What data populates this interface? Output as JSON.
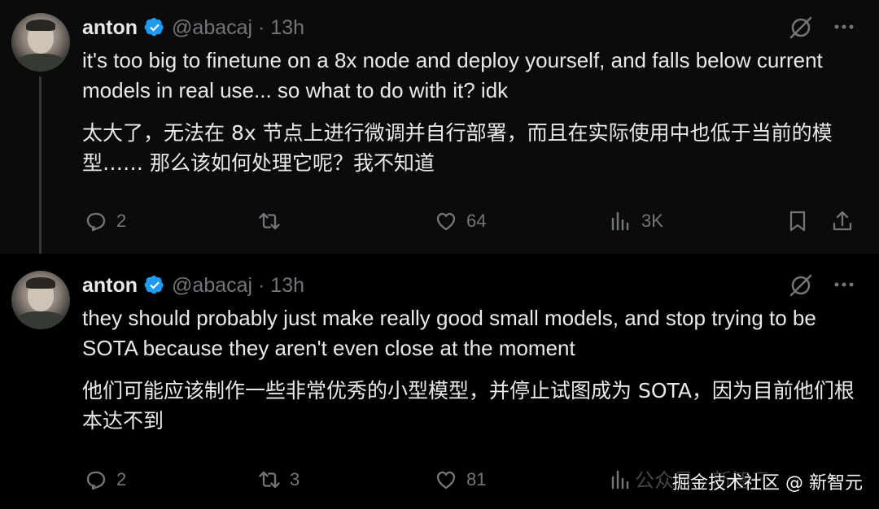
{
  "tweets": [
    {
      "author_name": "anton",
      "handle": "@abacaj · 13h",
      "text_en": "it's too big to finetune on a 8x node and deploy yourself, and falls below current models in real use... so what to do with it? idk",
      "text_zh": "太大了，无法在 8x 节点上进行微调并自行部署，而且在实际使用中也低于当前的模型…… 那么该如何处理它呢？我不知道",
      "replies": "2",
      "retweets": "",
      "likes": "64",
      "views": "3K"
    },
    {
      "author_name": "anton",
      "handle": "@abacaj · 13h",
      "text_en": "they should probably just make really good small models, and stop trying to be SOTA because they aren't even close at the moment",
      "text_zh": "他们可能应该制作一些非常优秀的小型模型，并停止试图成为 SOTA，因为目前他们根本达不到",
      "replies": "2",
      "retweets": "3",
      "likes": "81",
      "views": ""
    }
  ],
  "watermark_faded": "公众号 · 新智元",
  "watermark": "掘金技术社区 @ 新智元",
  "colors": {
    "background": "#000000",
    "text": "#e7e9ea",
    "muted": "#71767b",
    "verified": "#1d9bf0"
  }
}
